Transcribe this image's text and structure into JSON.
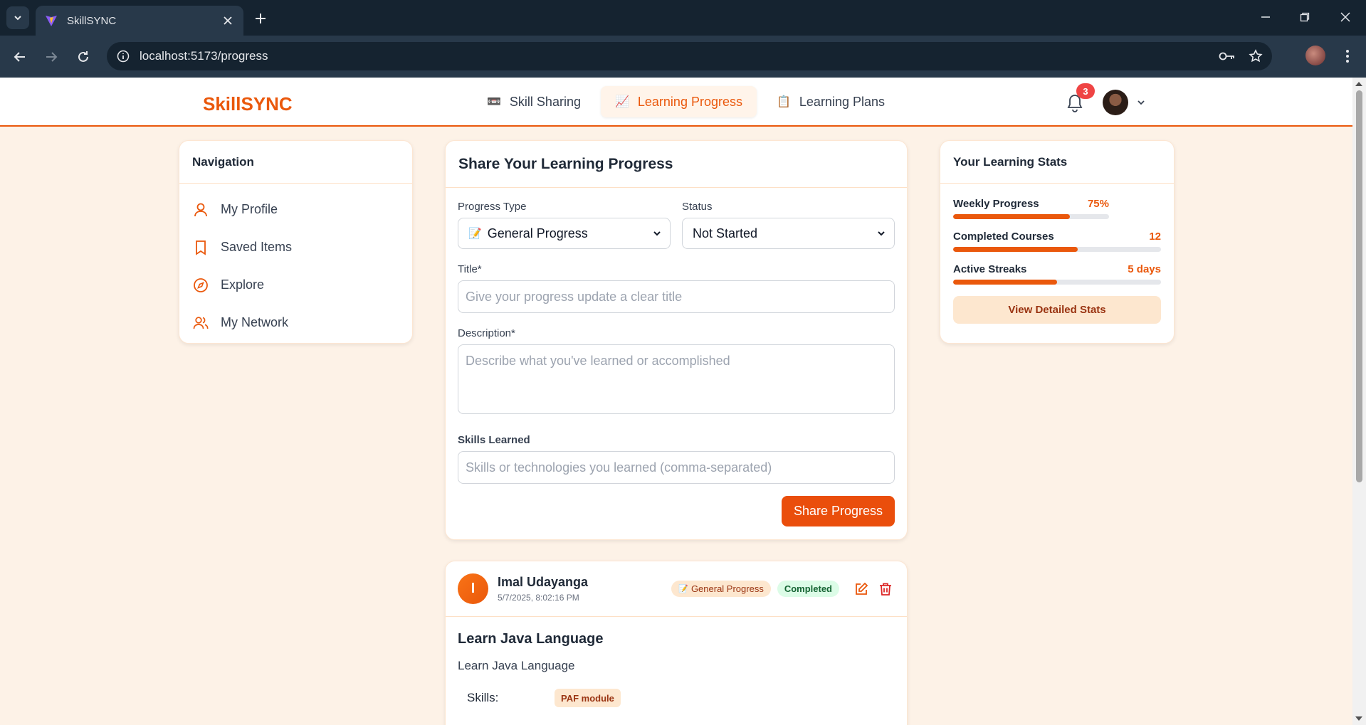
{
  "browser": {
    "tab_title": "SkillSYNC",
    "url": "localhost:5173/progress"
  },
  "header": {
    "logo": "SkillSYNC",
    "nav": [
      {
        "label": "Skill Sharing",
        "icon": "📼",
        "active": false
      },
      {
        "label": "Learning Progress",
        "icon": "📈",
        "active": true
      },
      {
        "label": "Learning Plans",
        "icon": "📋",
        "active": false
      }
    ],
    "notification_count": "3"
  },
  "sidebar": {
    "title": "Navigation",
    "items": [
      {
        "label": "My Profile",
        "icon": "user-icon"
      },
      {
        "label": "Saved Items",
        "icon": "bookmark-icon"
      },
      {
        "label": "Explore",
        "icon": "compass-icon"
      },
      {
        "label": "My Network",
        "icon": "users-icon"
      }
    ]
  },
  "form": {
    "title": "Share Your Learning Progress",
    "progress_type_label": "Progress Type",
    "progress_type_value": "General Progress",
    "progress_type_icon": "📝",
    "status_label": "Status",
    "status_value": "Not Started",
    "title_label": "Title*",
    "title_placeholder": "Give your progress update a clear title",
    "description_label": "Description*",
    "description_placeholder": "Describe what you've learned or accomplished",
    "skills_label": "Skills Learned",
    "skills_placeholder": "Skills or technologies you learned (comma-separated)",
    "submit_label": "Share Progress"
  },
  "stats": {
    "title": "Your Learning Stats",
    "items": [
      {
        "label": "Weekly Progress",
        "value": "75%",
        "fill": 0.75
      },
      {
        "label": "Completed Courses",
        "value": "12",
        "fill": 0.6
      },
      {
        "label": "Active Streaks",
        "value": "5 days",
        "fill": 0.5
      }
    ],
    "button_label": "View Detailed Stats"
  },
  "post": {
    "avatar_initial": "I",
    "author": "Imal Udayanga",
    "date": "5/7/2025, 8:02:16 PM",
    "type_chip": "General Progress",
    "type_icon": "📝",
    "status_chip": "Completed",
    "title": "Learn Java Language",
    "description": "Learn Java Language",
    "skills_label": "Skills:",
    "skills": [
      "PAF module"
    ]
  },
  "colors": {
    "accent": "#ea580c",
    "badge": "#ef4444",
    "page_bg": "#fdf2e7"
  }
}
